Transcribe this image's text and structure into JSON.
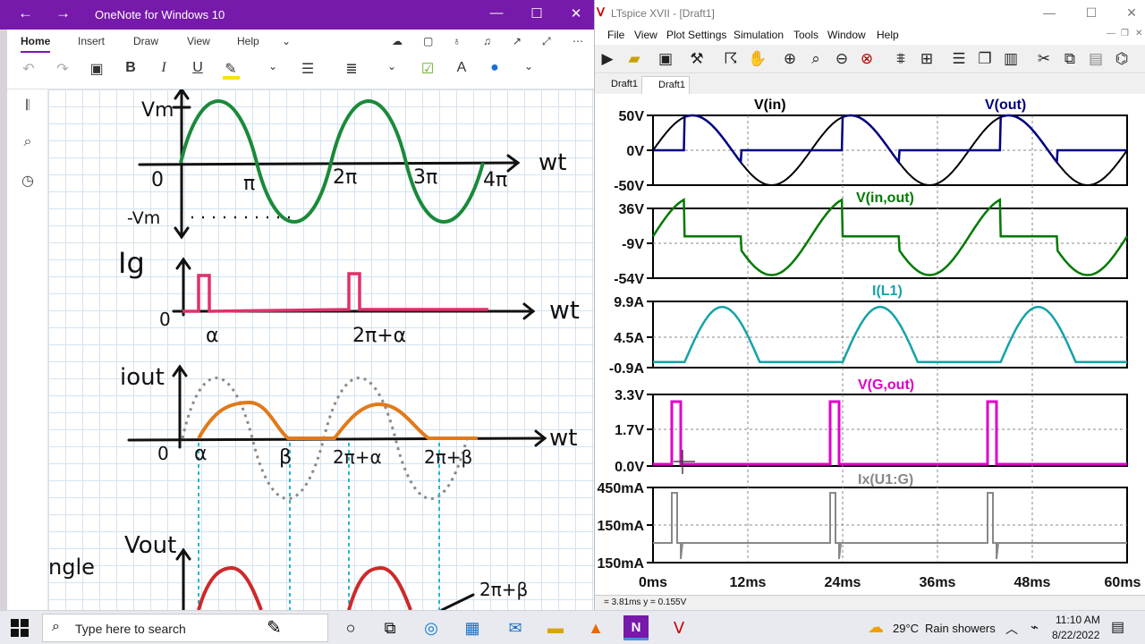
{
  "onenote": {
    "title": "OneNote for Windows 10",
    "tabs": [
      "Home",
      "Insert",
      "Draw",
      "View",
      "Help"
    ],
    "notes": {
      "vm": "Vm",
      "neg_vm": "-Vm",
      "origin": "0",
      "wt": "wt",
      "pi": "π",
      "two_pi": "2π",
      "three_pi": "3π",
      "four_pi": "4π",
      "ig": "Ig",
      "alpha": "α",
      "two_pi_alpha": "2π+α",
      "iout": "iout",
      "beta": "β",
      "two_pi_beta": "2π+β",
      "vout": "Vout",
      "angle": "ngle"
    }
  },
  "ltspice": {
    "title": "LTspice XVII - [Draft1]",
    "menu": [
      "File",
      "View",
      "Plot Settings",
      "Simulation",
      "Tools",
      "Window",
      "Help"
    ],
    "tabs": [
      "Draft1",
      "Draft1"
    ],
    "status": "= 3.81ms    y = 0.155V",
    "x_ticks": [
      "0ms",
      "12ms",
      "24ms",
      "36ms",
      "48ms",
      "60ms"
    ],
    "panes": [
      {
        "traces": [
          "V(in)",
          "V(out)"
        ],
        "ticks": [
          "50V",
          "0V",
          "-50V"
        ],
        "colors": [
          "#000000",
          "#000080"
        ]
      },
      {
        "traces": [
          "V(in,out)"
        ],
        "ticks": [
          "36V",
          "-9V",
          "-54V"
        ],
        "colors": [
          "#007a00"
        ]
      },
      {
        "traces": [
          "I(L1)"
        ],
        "ticks": [
          "9.9A",
          "4.5A",
          "-0.9A"
        ],
        "colors": [
          "#14a3a8"
        ]
      },
      {
        "traces": [
          "V(G,out)"
        ],
        "ticks": [
          "3.3V",
          "1.7V",
          "0.0V"
        ],
        "colors": [
          "#e000c8"
        ]
      },
      {
        "traces": [
          "Ix(U1:G)"
        ],
        "ticks": [
          "450mA",
          "150mA",
          "150mA"
        ],
        "colors": [
          "#888888"
        ]
      }
    ]
  },
  "taskbar": {
    "search_placeholder": "Type here to search",
    "weather_temp": "29°C",
    "weather_text": "Rain showers",
    "time": "11:10 AM",
    "date": "8/22/2022"
  }
}
